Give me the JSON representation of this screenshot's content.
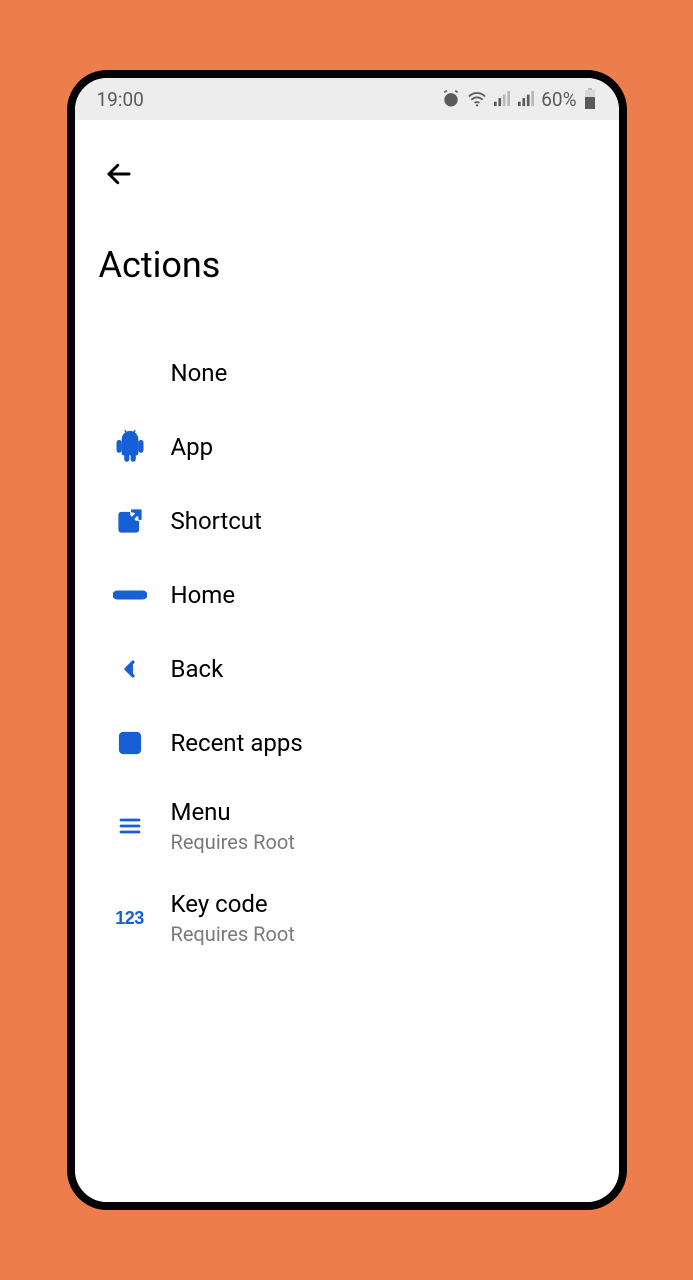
{
  "status": {
    "time": "19:00",
    "battery": "60%"
  },
  "page": {
    "title": "Actions"
  },
  "items": [
    {
      "label": "None",
      "sub": null
    },
    {
      "label": "App",
      "sub": null
    },
    {
      "label": "Shortcut",
      "sub": null
    },
    {
      "label": "Home",
      "sub": null
    },
    {
      "label": "Back",
      "sub": null
    },
    {
      "label": "Recent apps",
      "sub": null
    },
    {
      "label": "Menu",
      "sub": "Requires Root"
    },
    {
      "label": "Key code",
      "sub": "Requires Root"
    }
  ],
  "keycode_glyph": "123"
}
